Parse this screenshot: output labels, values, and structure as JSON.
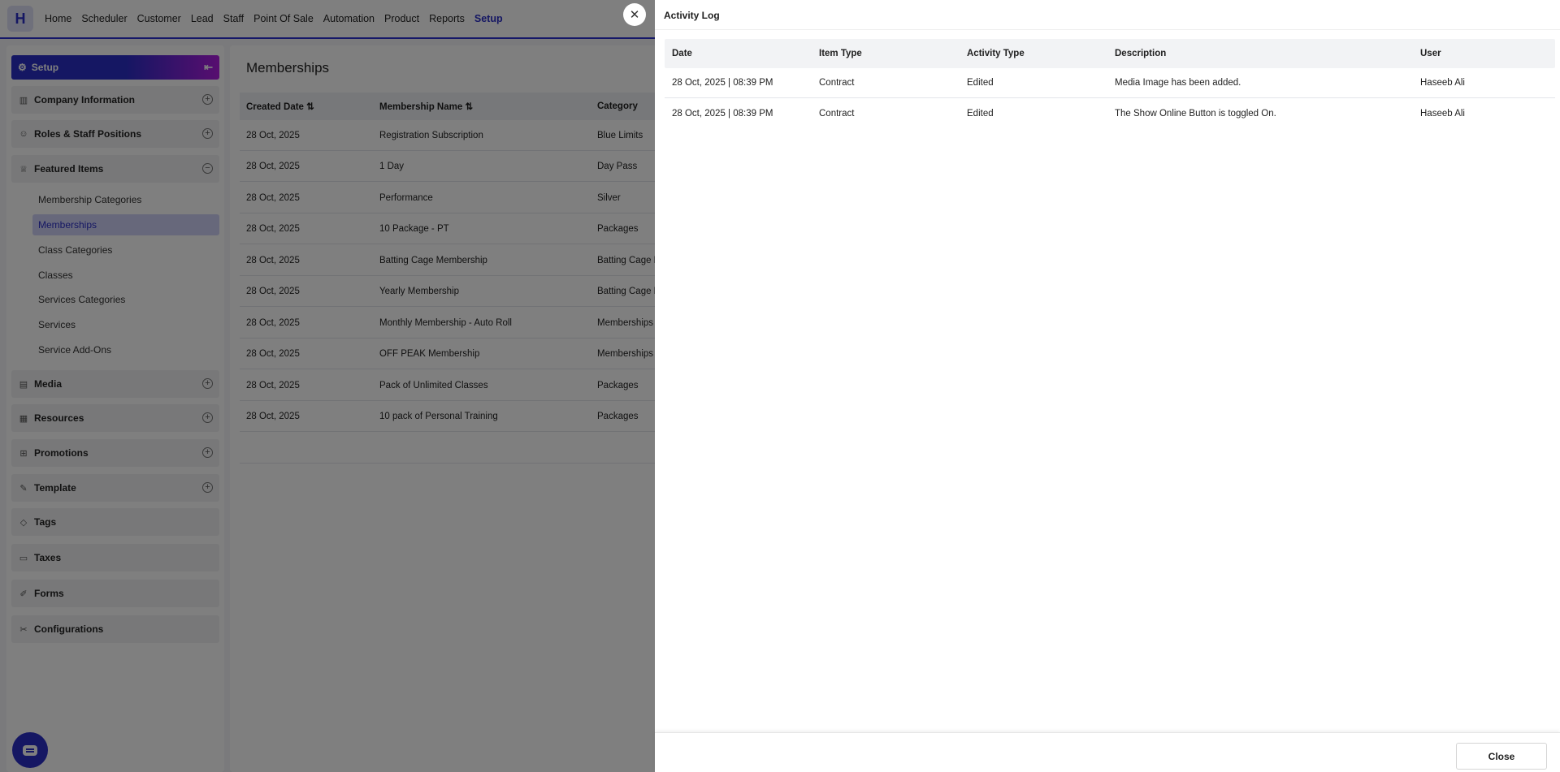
{
  "logo_letter": "H",
  "nav": [
    "Home",
    "Scheduler",
    "Customer",
    "Lead",
    "Staff",
    "Point Of Sale",
    "Automation",
    "Product",
    "Reports",
    "Setup"
  ],
  "sidebar": {
    "setup_label": "Setup",
    "sections": [
      {
        "label": "Company Information",
        "icon": "building-icon",
        "toggle": "+"
      },
      {
        "label": "Roles & Staff Positions",
        "icon": "users-icon",
        "toggle": "+"
      },
      {
        "label": "Featured Items",
        "icon": "crown-icon",
        "toggle": "−"
      }
    ],
    "featured_items": [
      "Membership Categories",
      "Memberships",
      "Class Categories",
      "Classes",
      "Services Categories",
      "Services",
      "Service Add-Ons"
    ],
    "sections_after": [
      {
        "label": "Media",
        "icon": "media-icon",
        "toggle": "+"
      },
      {
        "label": "Resources",
        "icon": "resources-icon",
        "toggle": "+"
      },
      {
        "label": "Promotions",
        "icon": "gift-icon",
        "toggle": "+"
      },
      {
        "label": "Template",
        "icon": "wand-icon",
        "toggle": "+"
      },
      {
        "label": "Tags",
        "icon": "tag-icon"
      },
      {
        "label": "Taxes",
        "icon": "taxes-icon"
      },
      {
        "label": "Forms",
        "icon": "forms-icon"
      },
      {
        "label": "Configurations",
        "icon": "wrench-icon"
      }
    ]
  },
  "main": {
    "title": "Memberships",
    "headers": [
      "Created Date ⇅",
      "Membership Name ⇅",
      "Category"
    ],
    "rows": [
      [
        "28 Oct, 2025",
        "Registration Subscription",
        "Blue Limits"
      ],
      [
        "28 Oct, 2025",
        "1 Day",
        "Day Pass"
      ],
      [
        "28 Oct, 2025",
        "Performance",
        "Silver"
      ],
      [
        "28 Oct, 2025",
        "10 Package - PT",
        "Packages"
      ],
      [
        "28 Oct, 2025",
        "Batting Cage Membership",
        "Batting Cage M"
      ],
      [
        "28 Oct, 2025",
        "Yearly Membership",
        "Batting Cage M"
      ],
      [
        "28 Oct, 2025",
        "Monthly Membership - Auto Roll",
        "Memberships"
      ],
      [
        "28 Oct, 2025",
        "OFF PEAK Membership",
        "Memberships"
      ],
      [
        "28 Oct, 2025",
        "Pack of Unlimited Classes",
        "Packages"
      ],
      [
        "28 Oct, 2025",
        "10 pack of Personal Training",
        "Packages"
      ]
    ]
  },
  "drawer": {
    "title": "Activity Log",
    "headers": [
      "Date",
      "Item Type",
      "Activity Type",
      "Description",
      "User"
    ],
    "rows": [
      [
        "28 Oct, 2025 | 08:39 PM",
        "Contract",
        "Edited",
        "Media Image has been added.",
        "Haseeb Ali"
      ],
      [
        "28 Oct, 2025 | 08:39 PM",
        "Contract",
        "Edited",
        "The Show Online Button is toggled On.",
        "Haseeb Ali"
      ]
    ],
    "close_label": "Close",
    "x_glyph": "✕"
  }
}
